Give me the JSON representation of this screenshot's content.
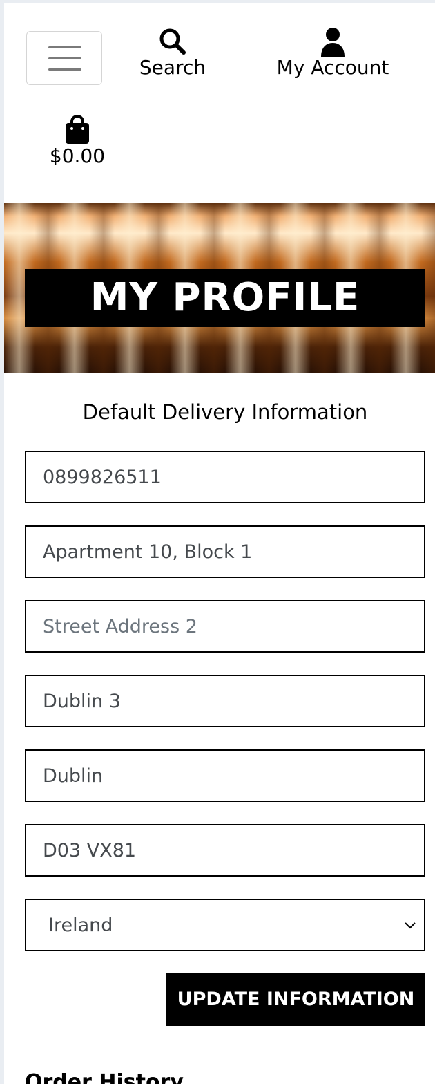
{
  "header": {
    "menu_toggle": {
      "icon": "hamburger-icon"
    },
    "search": {
      "label": "Search",
      "icon": "search-icon"
    },
    "account": {
      "label": "My Account",
      "icon": "user-icon"
    },
    "bag": {
      "total": "$0.00",
      "icon": "shopping-bag-icon"
    }
  },
  "hero": {
    "title": "MY PROFILE"
  },
  "form": {
    "heading": "Default Delivery Information",
    "phone": {
      "value": "0899826511"
    },
    "street_address_1": {
      "value": "Apartment 10, Block 1"
    },
    "street_address_2": {
      "value": "",
      "placeholder": "Street Address 2"
    },
    "town": {
      "value": "Dublin 3"
    },
    "county": {
      "value": "Dublin"
    },
    "postcode": {
      "value": "D03 VX81"
    },
    "country": {
      "selected": "Ireland",
      "icon": "chevron-down-icon"
    },
    "submit_label": "UPDATE INFORMATION"
  },
  "order_history": {
    "heading": "Order History"
  },
  "colors": {
    "background": "#ffffff",
    "title_bg": "#000000",
    "title_text": "#ffffff",
    "field_border": "#000000",
    "field_text": "#45494d",
    "placeholder_text": "#6c757d"
  }
}
